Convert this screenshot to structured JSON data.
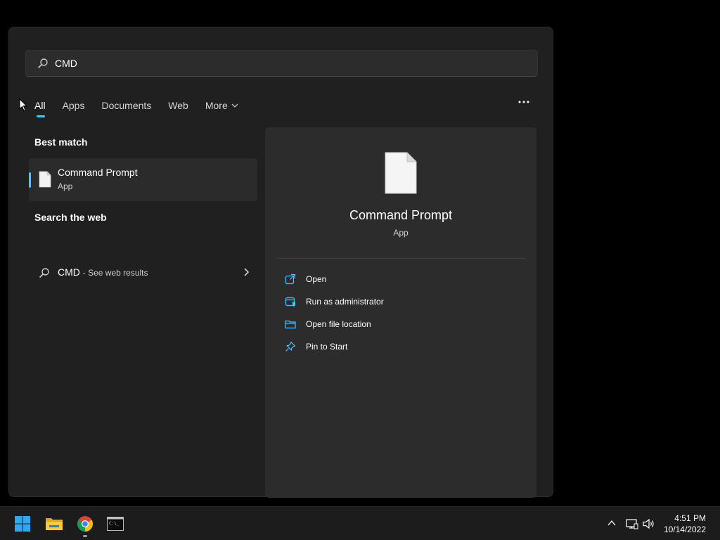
{
  "search": {
    "query": "CMD"
  },
  "tabs": [
    {
      "label": "All",
      "active": true
    },
    {
      "label": "Apps"
    },
    {
      "label": "Documents"
    },
    {
      "label": "Web"
    },
    {
      "label": "More"
    }
  ],
  "results": {
    "best_match_title": "Best match",
    "best_match": {
      "title": "Command Prompt",
      "type": "App",
      "icon": "file-icon"
    },
    "web_title": "Search the web",
    "web": {
      "query": "CMD",
      "suffix": "- See web results",
      "icon": "search-icon"
    }
  },
  "detail": {
    "name": "Command Prompt",
    "type": "App",
    "actions": [
      {
        "label": "Open",
        "icon": "open-external-icon"
      },
      {
        "label": "Run as administrator",
        "icon": "shield-admin-icon"
      },
      {
        "label": "Open file location",
        "icon": "folder-icon"
      },
      {
        "label": "Pin to Start",
        "icon": "pin-icon"
      }
    ]
  },
  "taskbar": {
    "apps": [
      {
        "name": "Start",
        "icon": "windows-start-icon"
      },
      {
        "name": "File Explorer",
        "icon": "folder-icon"
      },
      {
        "name": "Google Chrome",
        "icon": "chrome-icon"
      },
      {
        "name": "Command Prompt",
        "icon": "terminal-icon"
      }
    ],
    "clock": {
      "time": "4:51 PM",
      "date": "10/14/2022"
    }
  },
  "colors": {
    "accent": "#4cc2ff",
    "panel": "#202020",
    "detail_panel": "#2c2c2c",
    "taskbar": "#1c1c1c"
  }
}
